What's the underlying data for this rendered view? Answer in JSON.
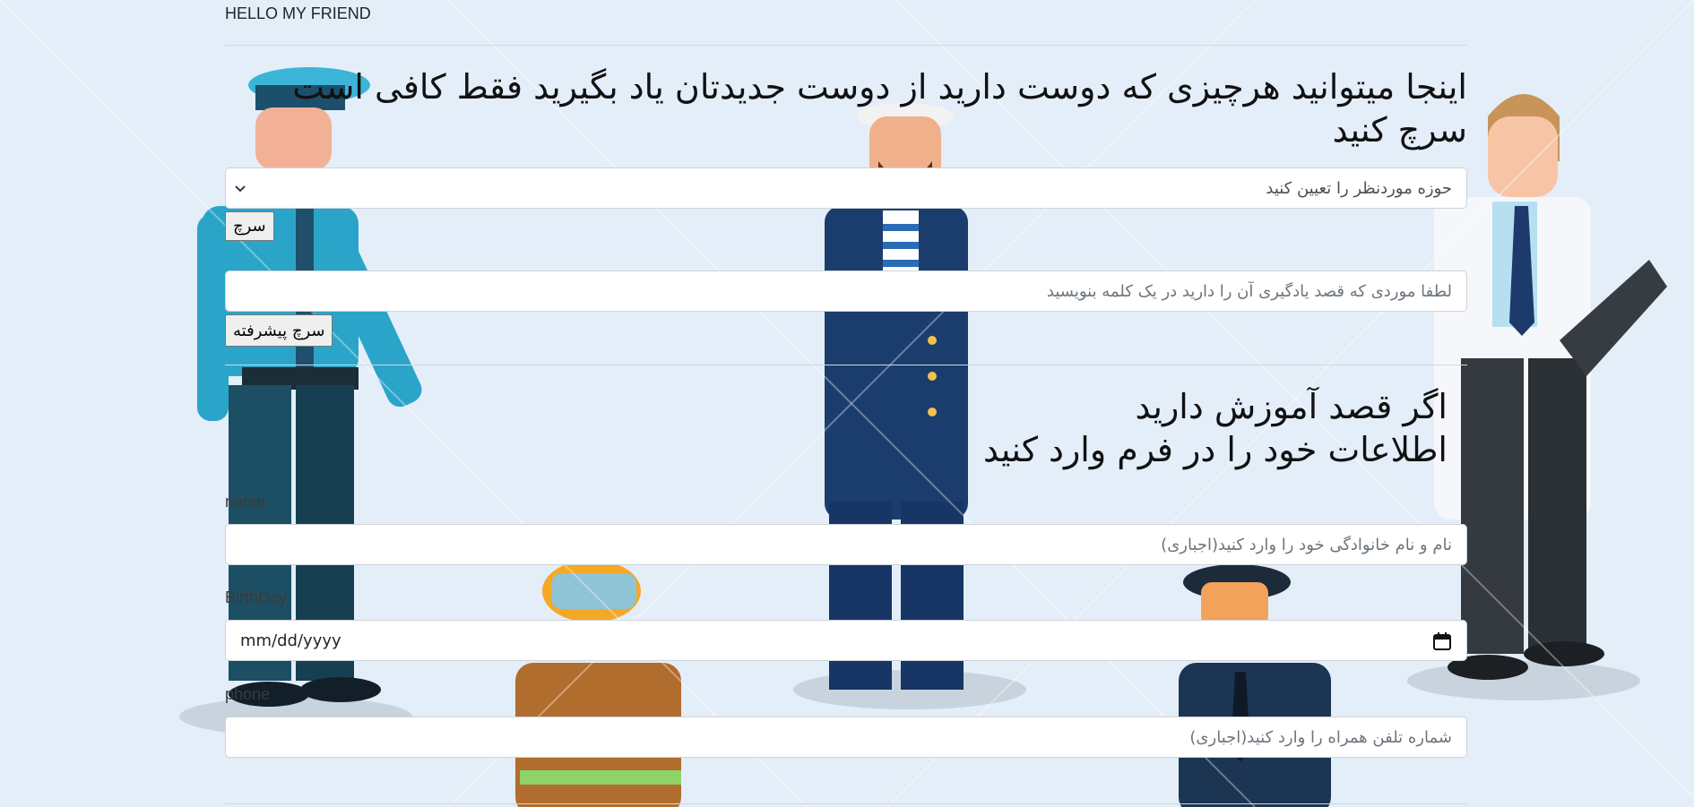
{
  "header": {
    "brand": "HELLO MY FRIEND"
  },
  "search": {
    "title": "اینجا میتوانید هرچیزی که دوست دارید از دوست جدیدتان یاد بگیرید فقط کافی است سرچ کنید",
    "category_select_value": "حوزه موردنظر را تعیین کنید",
    "search_button": "سرچ",
    "keyword_placeholder": "لطفا موردی که قصد یادگیری آن را دارید در یک  کلمه بنویسید",
    "advanced_search_button": "سرچ پیشرفته"
  },
  "form": {
    "title_line1": "اگر قصد آموزش دارید",
    "title_line2": "اطلاعات خود را در فرم وارد کنید",
    "name_label": "name",
    "name_placeholder": "نام و نام خانوادگی خود را وارد کنید(اجباری)",
    "birthday_label": "BirthDay",
    "birthday_placeholder": "mm/dd/yyyy",
    "phone_label": "phone",
    "phone_placeholder": "شماره تلفن همراه را وارد کنید(اجباری)"
  },
  "colors": {
    "page_background": "#e3eef9",
    "input_border": "#ced4da",
    "button_background": "#efefef"
  }
}
